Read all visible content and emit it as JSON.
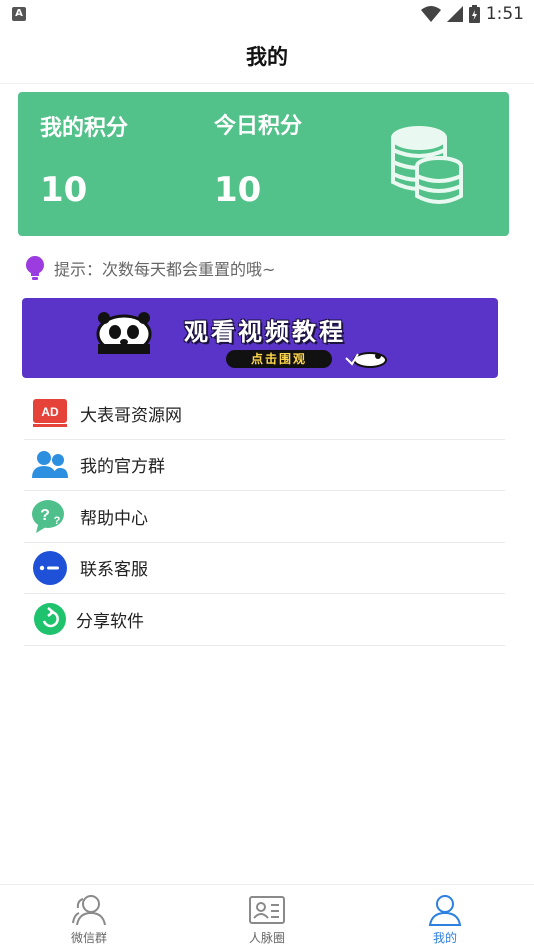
{
  "status_bar": {
    "left_icon_letter": "A",
    "time": "1:51",
    "icons": [
      "wifi-icon",
      "signal-icon",
      "battery-icon"
    ]
  },
  "header": {
    "title": "我的"
  },
  "points_card": {
    "my_points_label": "我的积分",
    "my_points_value": "10",
    "today_points_label": "今日积分",
    "today_points_value": "10",
    "background_color": "#52c18a",
    "icon": "coins-icon"
  },
  "tip": {
    "icon": "lightbulb-icon",
    "text": "提示：次数每天都会重置的哦~"
  },
  "banner": {
    "title": "观看视频教程",
    "cta": "点击围观",
    "background_color": "#5a33c8"
  },
  "menu": {
    "items": [
      {
        "label": "大表哥资源网",
        "icon": "ad-icon"
      },
      {
        "label": "我的官方群",
        "icon": "group-icon"
      },
      {
        "label": "帮助中心",
        "icon": "help-icon"
      },
      {
        "label": "联系客服",
        "icon": "chat-icon"
      },
      {
        "label": "分享软件",
        "icon": "share-icon"
      }
    ]
  },
  "bottom_nav": {
    "items": [
      {
        "label": "微信群",
        "icon": "wechat-group-icon",
        "active": false
      },
      {
        "label": "人脉圈",
        "icon": "contacts-card-icon",
        "active": false
      },
      {
        "label": "我的",
        "icon": "profile-icon",
        "active": true
      }
    ],
    "active_color": "#2d7fe0"
  }
}
